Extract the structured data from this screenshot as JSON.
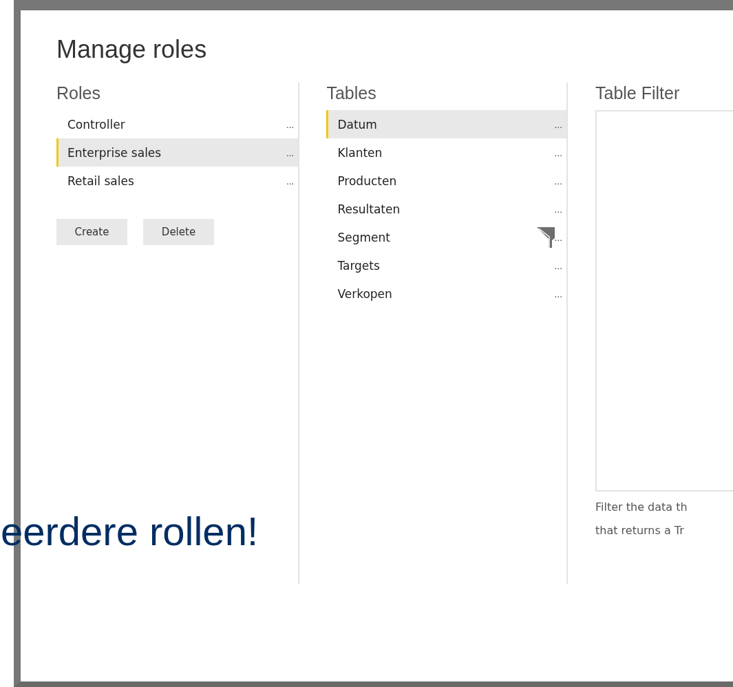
{
  "dialog": {
    "title": "Manage roles"
  },
  "roles": {
    "heading": "Roles",
    "items": [
      {
        "label": "Controller",
        "selected": false,
        "more": "..."
      },
      {
        "label": "Enterprise sales",
        "selected": true,
        "more": "..."
      },
      {
        "label": "Retail sales",
        "selected": false,
        "more": "..."
      }
    ],
    "buttons": [
      "Create",
      "Delete"
    ]
  },
  "tables": {
    "heading": "Tables",
    "items": [
      {
        "label": "Datum",
        "selected": true,
        "filtered": false,
        "more": "..."
      },
      {
        "label": "Klanten",
        "selected": false,
        "filtered": false,
        "more": "..."
      },
      {
        "label": "Producten",
        "selected": false,
        "filtered": false,
        "more": "..."
      },
      {
        "label": "Resultaten",
        "selected": false,
        "filtered": false,
        "more": "..."
      },
      {
        "label": "Segment",
        "selected": false,
        "filtered": true,
        "more": "..."
      },
      {
        "label": "Targets",
        "selected": false,
        "filtered": false,
        "more": "..."
      },
      {
        "label": "Verkopen",
        "selected": false,
        "filtered": false,
        "more": "..."
      }
    ]
  },
  "table_filter": {
    "heading": "Table Filter",
    "hint_lines": [
      "Filter the data th",
      "that returns a Tr"
    ]
  },
  "overlay_text": "eerdere rollen!"
}
